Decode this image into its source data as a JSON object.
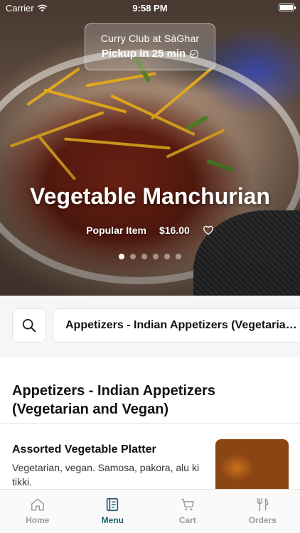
{
  "status_bar": {
    "carrier": "Carrier",
    "time": "9:58 PM"
  },
  "pickup": {
    "restaurant": "Curry Club at SāGhar",
    "eta": "Pickup in 25 min"
  },
  "hero": {
    "title": "Vegetable Manchurian",
    "tag": "Popular Item",
    "price": "$16.00",
    "slides_total": 6,
    "active_slide": 1
  },
  "search": {
    "icon": "search-icon"
  },
  "category_selector": {
    "current": "Appetizers - Indian Appetizers (Vegetarian and Vegan)"
  },
  "section": {
    "title": "Appetizers - Indian Appetizers (Vegetarian and Vegan)"
  },
  "items": [
    {
      "name": "Assorted Vegetable Platter",
      "description": "Vegetarian, vegan. Samosa, pakora, alu ki tikki."
    }
  ],
  "tabs": [
    {
      "label": "Home",
      "icon": "home-icon",
      "active": false
    },
    {
      "label": "Menu",
      "icon": "menu-icon",
      "active": true
    },
    {
      "label": "Cart",
      "icon": "cart-icon",
      "active": false
    },
    {
      "label": "Orders",
      "icon": "orders-icon",
      "active": false
    }
  ],
  "colors": {
    "accent": "#1f5f6b",
    "inactive_tab": "#9a9a9a"
  }
}
